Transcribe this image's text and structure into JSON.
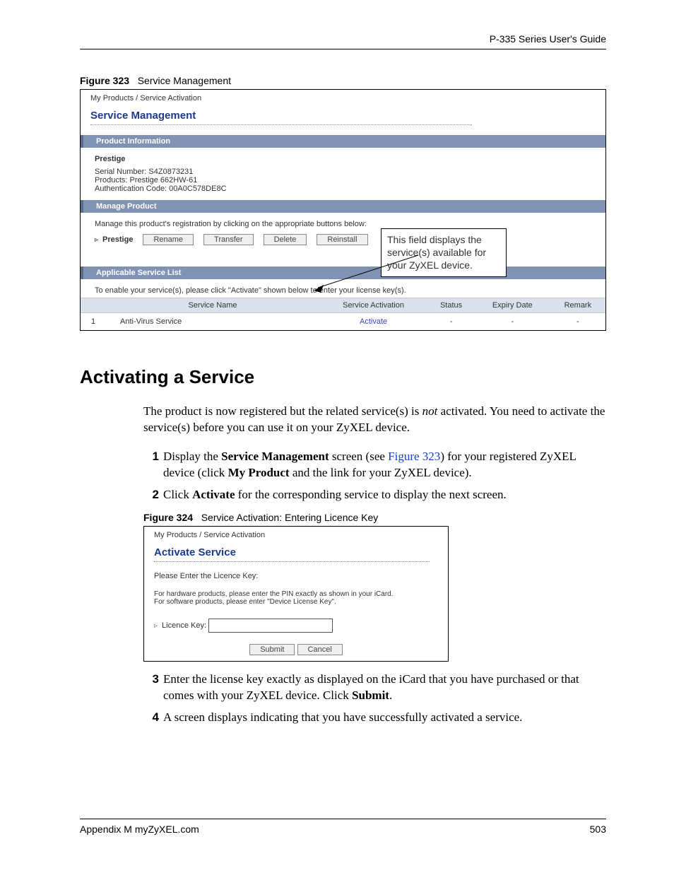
{
  "header": {
    "title": "P-335 Series User's Guide"
  },
  "fig323": {
    "caption_label": "Figure 323",
    "caption_text": "Service Management",
    "breadcrumb": "My Products / Service Activation",
    "title": "Service Management",
    "sec_product_info": "Product Information",
    "product_name": "Prestige",
    "serial": "Serial Number: S4Z0873231",
    "products": "Products: Prestige 662HW-61",
    "auth": "Authentication Code: 00A0C578DE8C",
    "sec_manage": "Manage Product",
    "manage_instr": "Manage this product's registration by clicking on the appropriate buttons below:",
    "row_name": "Prestige",
    "btn_rename": "Rename",
    "btn_transfer": "Transfer",
    "btn_delete": "Delete",
    "btn_reinstall": "Reinstall",
    "sec_service_list": "Applicable Service List",
    "enable_instr": "To enable your service(s), please click \"Activate\" shown below to enter your license key(s).",
    "cols": {
      "name": "Service Name",
      "activation": "Service Activation",
      "status": "Status",
      "expiry": "Expiry Date",
      "remark": "Remark"
    },
    "row": {
      "idx": "1",
      "name": "Anti-Virus Service",
      "activation": "Activate",
      "status": "-",
      "expiry": "-",
      "remark": "-"
    },
    "callout": "This field displays the service(s) available for your ZyXEL device."
  },
  "section": {
    "heading": "Activating a Service",
    "intro_a": "The product is now registered but the related service(s) is ",
    "intro_not": "not",
    "intro_b": " activated. You need to activate the service(s) before you can use it on your ZyXEL device.",
    "steps": {
      "s1a": "Display the ",
      "s1b": "Service Management",
      "s1c": " screen (see ",
      "s1d": "Figure 323",
      "s1e": ") for your registered ZyXEL device (click ",
      "s1f": "My Product",
      "s1g": " and the link for your ZyXEL device).",
      "s2a": "Click ",
      "s2b": "Activate",
      "s2c": " for the corresponding service to display the next screen.",
      "s3a": "Enter the license key exactly as displayed on the iCard that you have purchased or that comes with your ZyXEL device. Click ",
      "s3b": "Submit",
      "s3c": ".",
      "s4": "A screen displays indicating that you have successfully activated a service."
    }
  },
  "fig324": {
    "caption_label": "Figure 324",
    "caption_text": "Service Activation: Entering Licence Key",
    "breadcrumb": "My Products / Service Activation",
    "title": "Activate Service",
    "enter_msg": "Please Enter the Licence Key:",
    "hw_msg": "For hardware products, please enter the PIN exactly as shown in your iCard.",
    "sw_msg": "For software products, please enter \"Device License Key\".",
    "label": "Licence Key:",
    "btn_submit": "Submit",
    "btn_cancel": "Cancel"
  },
  "footer": {
    "left": "Appendix M myZyXEL.com",
    "right": "503"
  }
}
